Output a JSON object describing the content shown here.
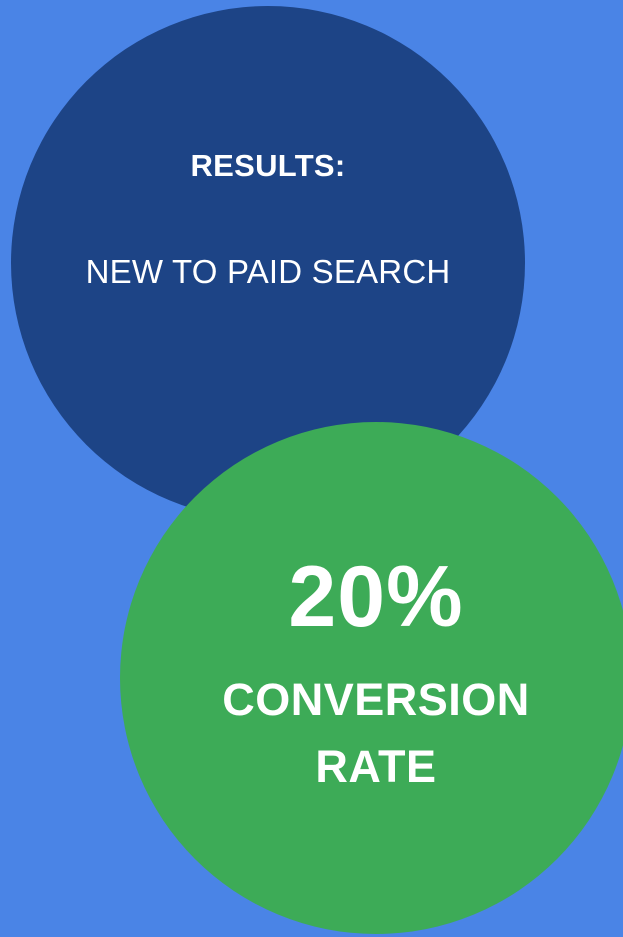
{
  "colors": {
    "background": "#4a84e6",
    "blue_circle": "#1d4486",
    "green_circle": "#3dab57",
    "text": "#ffffff"
  },
  "results": {
    "heading": "RESULTS:",
    "subheading": "NEW TO PAID SEARCH"
  },
  "stat": {
    "value": "20%",
    "label_line1": "CONVERSION",
    "label_line2": "RATE"
  }
}
